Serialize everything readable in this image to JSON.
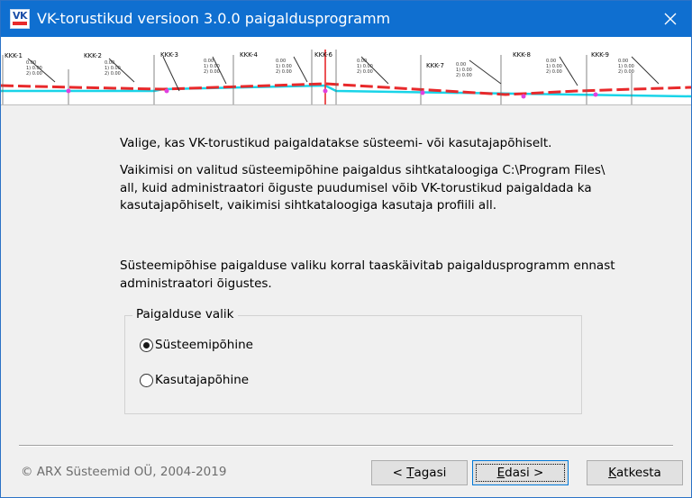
{
  "window": {
    "title": "VK-torustikud versioon 3.0.0 paigaldusprogramm",
    "icon_text": "VK"
  },
  "banner": {
    "labels": [
      "KKK-1",
      "KKK-2",
      "KKK-3",
      "KKK-4",
      "KKK-6",
      "KKK-7",
      "KKK-8",
      "KKK-9"
    ]
  },
  "content": {
    "paragraph1": "Valige, kas VK-torustikud paigaldatakse süsteemi- või kasutajapõhiselt.",
    "paragraph2": "Vaikimisi on valitud süsteemipõhine paigaldus sihtkataloogiga C:\\Program Files\\ all, kuid administraatori õiguste puudumisel võib VK-torustikud paigaldada ka kasutajapõhiselt, vaikimisi sihtkataloogiga kasutaja profiili all.",
    "paragraph3": "Süsteemipõhise paigalduse valiku korral taaskäivitab paigaldusprogramm ennast administraatori õigustes."
  },
  "install_choice": {
    "group_label": "Paigalduse valik",
    "options": [
      {
        "label": "Süsteemipõhine",
        "selected": true
      },
      {
        "label": "Kasutajapõhine",
        "selected": false
      }
    ]
  },
  "footer": {
    "copyright": "© ARX Süsteemid OÜ, 2004-2019",
    "back_pre": "< ",
    "back_key": "T",
    "back_rest": "agasi",
    "next_key": "E",
    "next_rest": "dasi >",
    "cancel_key": "K",
    "cancel_rest": "atkesta"
  },
  "colors": {
    "titlebar": "#0f6fd0",
    "pipe_red": "#e8292b",
    "pipe_cyan": "#19d4e8",
    "marker_magenta": "#e040e0"
  }
}
